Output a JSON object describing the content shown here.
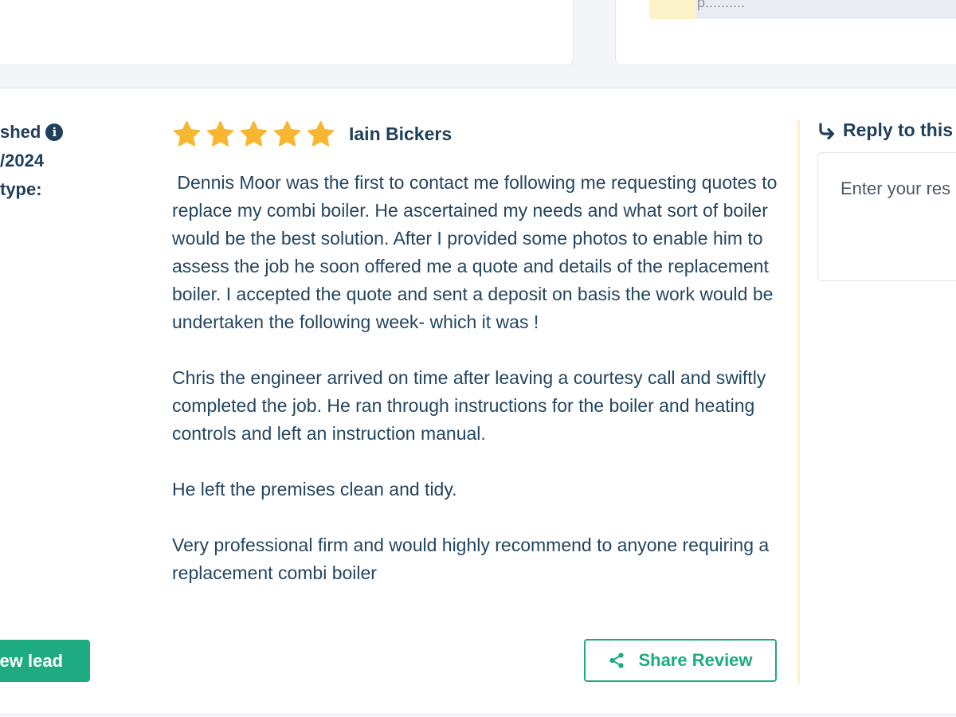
{
  "top": {
    "progress_text": "p..........",
    "progress_fill_fraction": 0.14
  },
  "meta": {
    "published_label": "shed",
    "date": "/2024",
    "type_label": "type:"
  },
  "review": {
    "rating": 5,
    "reviewer": "Iain Bickers",
    "paragraphs": [
      " Dennis Moor was the first to contact me following me requesting quotes to replace my combi boiler. He ascertained my needs and what sort of boiler would be the best solution. After I provided some photos to enable him to assess the job he soon offered me a quote and details of the replacement boiler. I accepted the quote and sent a deposit on basis the work would be undertaken the following week- which it was !",
      "Chris the engineer arrived on time after leaving a courtesy call and swiftly completed the job. He ran through instructions for the boiler and heating controls and left an instruction manual.",
      "He left the premises clean and tidy.",
      "Very professional firm and would highly recommend to anyone requiring a replacement combi boiler"
    ],
    "star_color": "#f7b731",
    "share_label": "Share Review",
    "view_lead_label": "ew lead"
  },
  "reply": {
    "title": "Reply to this",
    "placeholder": "Enter your res"
  },
  "colors": {
    "accent_green": "#1eab82",
    "text_navy": "#1f3f5a",
    "divider_yellow": "#fdf0c4"
  },
  "icons": {
    "info": "info-icon",
    "star": "star-icon",
    "share": "share-icon",
    "reply": "reply-arrow-icon"
  }
}
